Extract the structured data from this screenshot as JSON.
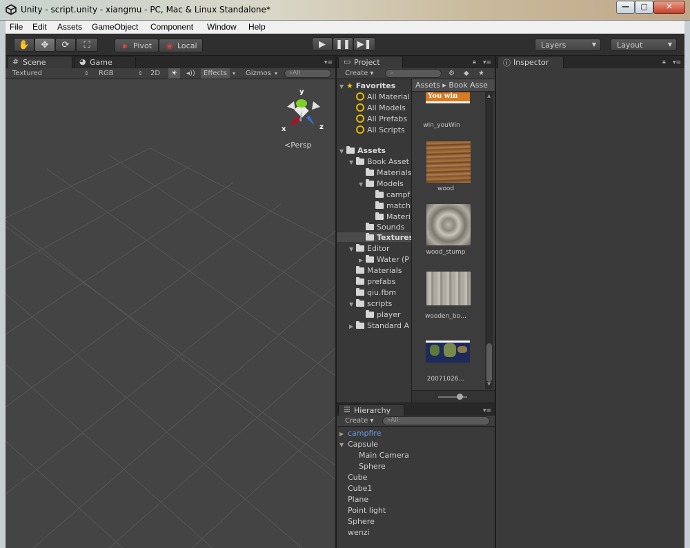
{
  "window": {
    "title": "Unity - script.unity - xiangmu - PC, Mac & Linux Standalone*",
    "min_label": "—",
    "max_label": "▢",
    "close_label": "✕"
  },
  "menu": {
    "items": [
      "File",
      "Edit",
      "Assets",
      "GameObject",
      "Component",
      "Window",
      "Help"
    ]
  },
  "toolbar": {
    "pivot_label": "Pivot",
    "local_label": "Local",
    "layers_label": "Layers",
    "layout_label": "Layout"
  },
  "scene": {
    "tab_scene": "Scene",
    "tab_game": "Game",
    "shading": "Textured",
    "channel": "RGB",
    "mode_2d": "2D",
    "effects": "Effects",
    "gizmos": "Gizmos",
    "search_placeholder": "All",
    "gizmo_y": "y",
    "gizmo_x": "x",
    "gizmo_z": "z",
    "persp_label": "Persp"
  },
  "project": {
    "tab_label": "Project",
    "create_label": "Create",
    "breadcrumb": "Assets ▸ Book Asse",
    "favorites_label": "Favorites",
    "favorites": [
      "All Material",
      "All Models",
      "All Prefabs",
      "All Scripts"
    ],
    "assets_label": "Assets",
    "tree": [
      {
        "label": "Book Asset",
        "depth": 1,
        "arrow": "▼"
      },
      {
        "label": "Materials",
        "depth": 2,
        "arrow": ""
      },
      {
        "label": "Models",
        "depth": 2,
        "arrow": "▼"
      },
      {
        "label": "campf",
        "depth": 3,
        "arrow": ""
      },
      {
        "label": "match",
        "depth": 3,
        "arrow": ""
      },
      {
        "label": "Materi",
        "depth": 3,
        "arrow": ""
      },
      {
        "label": "Sounds",
        "depth": 2,
        "arrow": ""
      },
      {
        "label": "Textures",
        "depth": 2,
        "arrow": ""
      },
      {
        "label": "Editor",
        "depth": 1,
        "arrow": "▼"
      },
      {
        "label": "Water (P",
        "depth": 2,
        "arrow": "▶"
      },
      {
        "label": "Materials",
        "depth": 1,
        "arrow": ""
      },
      {
        "label": "prefabs",
        "depth": 1,
        "arrow": ""
      },
      {
        "label": "qiu.fbm",
        "depth": 1,
        "arrow": ""
      },
      {
        "label": "scripts",
        "depth": 1,
        "arrow": "▼"
      },
      {
        "label": "player",
        "depth": 2,
        "arrow": ""
      },
      {
        "label": "Standard A",
        "depth": 1,
        "arrow": "▶"
      }
    ],
    "assets": [
      {
        "label": "win_youWin",
        "thumb_text": "You win"
      },
      {
        "label": "wood",
        "thumb_text": ""
      },
      {
        "label": "wood_stump",
        "thumb_text": ""
      },
      {
        "label": "wooden_bo…",
        "thumb_text": ""
      },
      {
        "label": "20071026…",
        "thumb_text": ""
      }
    ]
  },
  "hierarchy": {
    "tab_label": "Hierarchy",
    "create_label": "Create",
    "search_placeholder": "All",
    "items": [
      {
        "label": "campfire",
        "depth": 0,
        "arrow": "▶",
        "prefab": true
      },
      {
        "label": "Capsule",
        "depth": 0,
        "arrow": "▼",
        "prefab": false
      },
      {
        "label": "Main Camera",
        "depth": 1,
        "arrow": "",
        "prefab": false
      },
      {
        "label": "Sphere",
        "depth": 1,
        "arrow": "",
        "prefab": false
      },
      {
        "label": "Cube",
        "depth": 0,
        "arrow": "",
        "prefab": false
      },
      {
        "label": "Cube1",
        "depth": 0,
        "arrow": "",
        "prefab": false
      },
      {
        "label": "Plane",
        "depth": 0,
        "arrow": "",
        "prefab": false
      },
      {
        "label": "Point light",
        "depth": 0,
        "arrow": "",
        "prefab": false
      },
      {
        "label": "Sphere",
        "depth": 0,
        "arrow": "",
        "prefab": false
      },
      {
        "label": "wenzi",
        "depth": 0,
        "arrow": "",
        "prefab": false
      }
    ]
  },
  "inspector": {
    "tab_label": "Inspector"
  },
  "colors": {
    "panel_bg": "#3a3a3a",
    "scene_bg": "#444444",
    "prefab_text": "#6d9ff0",
    "gizmo_y": "#7ed321",
    "gizmo_x": "#d0021b",
    "gizmo_z": "#2f6fd8"
  }
}
